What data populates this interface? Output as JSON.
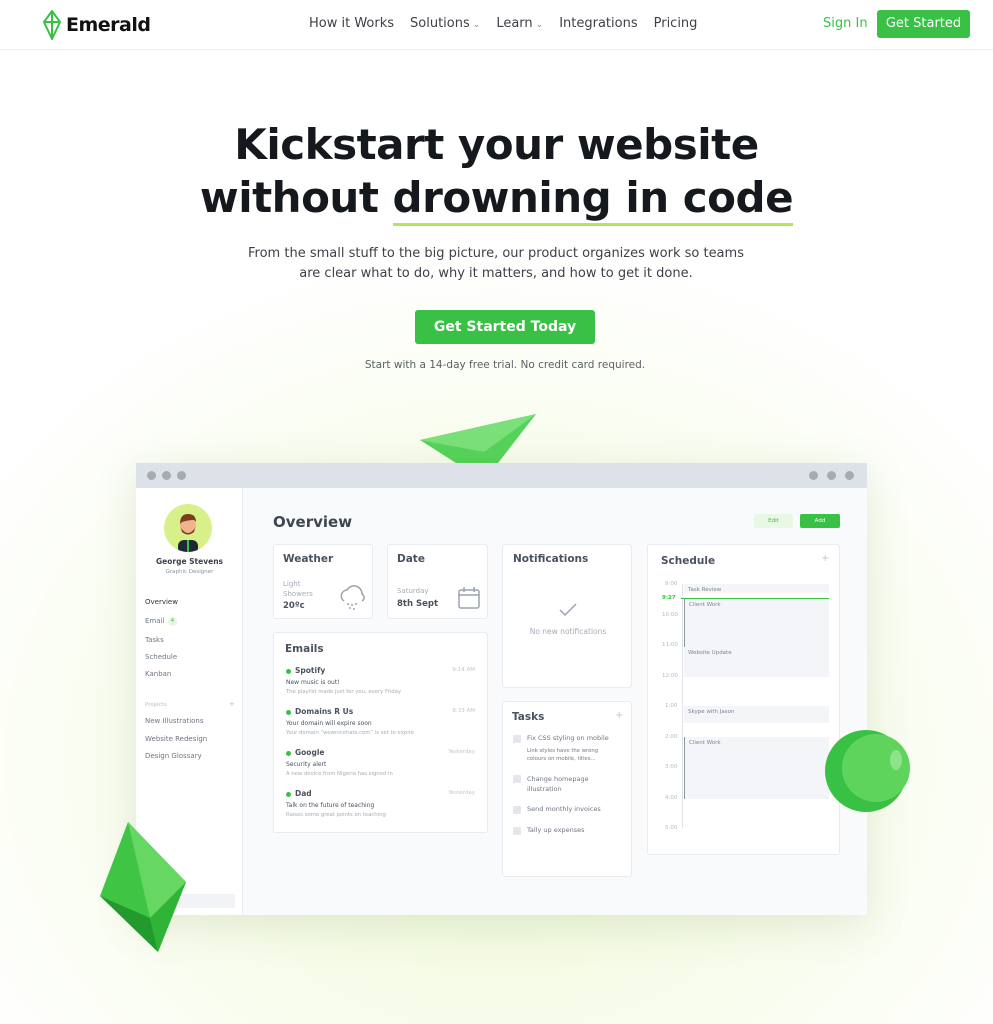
{
  "brand": {
    "name": "Emerald",
    "accent": "#38c145"
  },
  "nav": {
    "items": [
      {
        "label": "How it Works"
      },
      {
        "label": "Solutions",
        "dropdown": true
      },
      {
        "label": "Learn",
        "dropdown": true
      },
      {
        "label": "Integrations"
      },
      {
        "label": "Pricing"
      }
    ],
    "sign_in": "Sign In",
    "get_started": "Get Started"
  },
  "hero": {
    "title_line1": "Kickstart your website",
    "title_line2_a": "without ",
    "title_line2_b": "drowning in code",
    "subtitle": "From the small stuff to the big picture, our product organizes work so teams are clear what to do, why it matters, and how to get it done.",
    "cta": "Get Started Today",
    "note": "Start with a 14-day free trial. No credit card required."
  },
  "app": {
    "user": {
      "name": "George Stevens",
      "role": "Graphic Designer"
    },
    "sidebar": {
      "items": [
        {
          "label": "Overview"
        },
        {
          "label": "Email",
          "badge": "4"
        },
        {
          "label": "Tasks"
        },
        {
          "label": "Schedule"
        },
        {
          "label": "Kanban"
        }
      ],
      "projects_label": "Projects",
      "projects": [
        {
          "label": "New Illustrations"
        },
        {
          "label": "Website Redesign"
        },
        {
          "label": "Design Glossary"
        }
      ]
    },
    "title": "Overview",
    "edit": "Edit",
    "add": "Add",
    "weather": {
      "title": "Weather",
      "condition": "Light Showers",
      "temp": "20ºc"
    },
    "date": {
      "title": "Date",
      "day": "Saturday",
      "date": "8th Sept"
    },
    "notifications": {
      "title": "Notifications",
      "empty": "No new notifications"
    },
    "emails": {
      "title": "Emails",
      "items": [
        {
          "from": "Spotify",
          "time": "9:14 AM",
          "subject": "New music is out!",
          "preview": "The playlist made just for you, every Friday"
        },
        {
          "from": "Domains R Us",
          "time": "8:33 AM",
          "subject": "Your domain will expire soon",
          "preview": "Your domain “wownicehats.com” is set to expire"
        },
        {
          "from": "Google",
          "time": "Yesterday",
          "subject": "Security alert",
          "preview": "A new device from Nigeria has signed in"
        },
        {
          "from": "Dad",
          "time": "Yesterday",
          "subject": "Talk on the future of teaching",
          "preview": "Raises some great points on teaching"
        }
      ]
    },
    "tasks": {
      "title": "Tasks",
      "items": [
        {
          "label": "Fix CSS styling on mobile",
          "desc": "Link styles have the wrong colours on mobile, titles..."
        },
        {
          "label": "Change homepage illustration"
        },
        {
          "label": "Send monthly invoices"
        },
        {
          "label": "Tally up expenses"
        }
      ]
    },
    "schedule": {
      "title": "Schedule",
      "now": "9:27",
      "hours": [
        "9:00",
        "10:00",
        "11:00",
        "12:00",
        "1:00",
        "2:00",
        "3:00",
        "4:00",
        "5:00"
      ],
      "events": [
        {
          "label": "Task Review"
        },
        {
          "label": "Client Work"
        },
        {
          "label": "Website Update"
        },
        {
          "label": "Skype with Jason"
        },
        {
          "label": "Client Work"
        }
      ]
    }
  }
}
